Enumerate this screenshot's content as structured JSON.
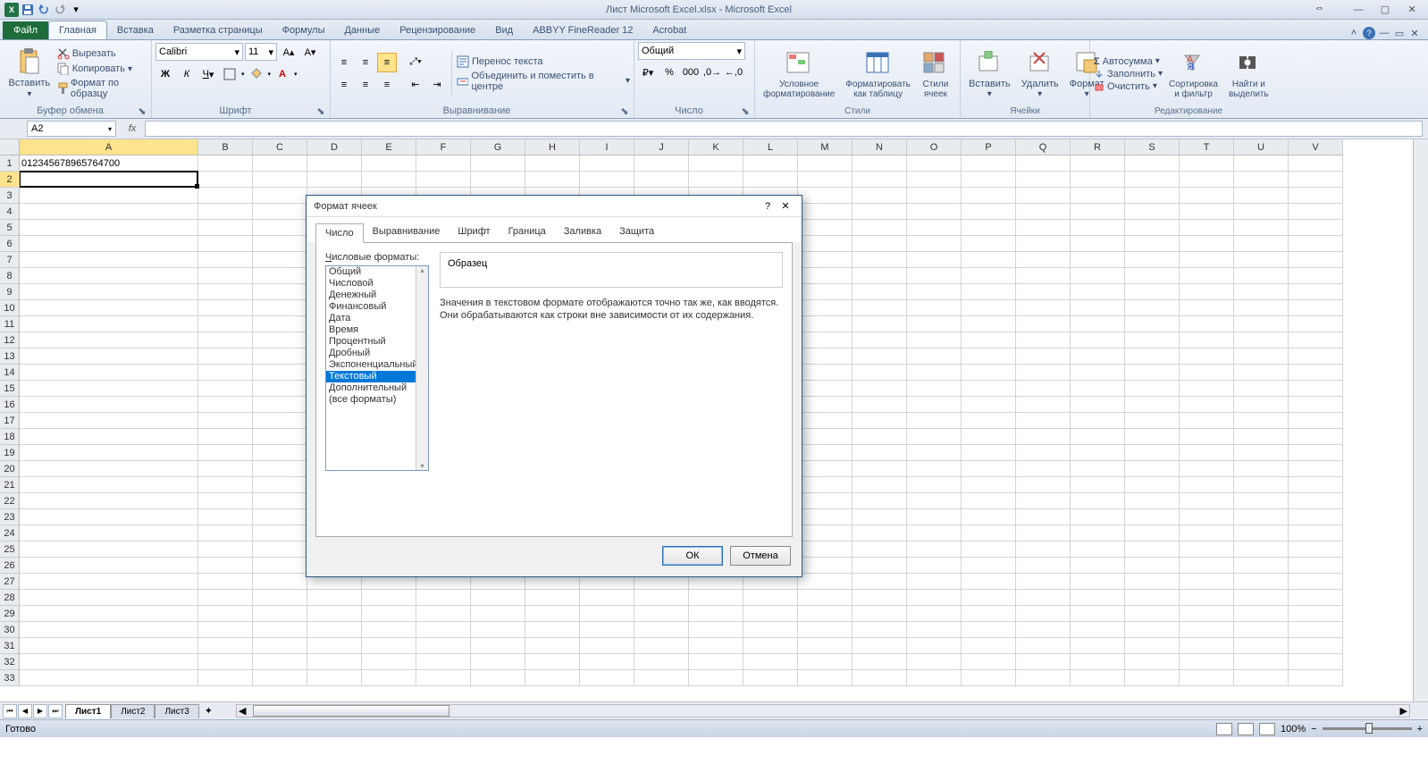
{
  "title": "Лист Microsoft Excel.xlsx - Microsoft Excel",
  "tabs": {
    "file": "Файл",
    "items": [
      "Главная",
      "Вставка",
      "Разметка страницы",
      "Формулы",
      "Данные",
      "Рецензирование",
      "Вид",
      "ABBYY FineReader 12",
      "Acrobat"
    ],
    "active": 0
  },
  "ribbon": {
    "clipboard": {
      "label": "Буфер обмена",
      "paste": "Вставить",
      "cut": "Вырезать",
      "copy": "Копировать",
      "format_painter": "Формат по образцу"
    },
    "font": {
      "label": "Шрифт",
      "name": "Calibri",
      "size": "11"
    },
    "alignment": {
      "label": "Выравнивание",
      "wrap": "Перенос текста",
      "merge": "Объединить и поместить в центре"
    },
    "number": {
      "label": "Число",
      "format": "Общий"
    },
    "styles": {
      "label": "Стили",
      "conditional": "Условное\nформатирование",
      "table": "Форматировать\nкак таблицу",
      "cell": "Стили\nячеек"
    },
    "cells": {
      "label": "Ячейки",
      "insert": "Вставить",
      "delete": "Удалить",
      "format": "Формат"
    },
    "editing": {
      "label": "Редактирование",
      "autosum": "Автосумма",
      "fill": "Заполнить",
      "clear": "Очистить",
      "sort": "Сортировка\nи фильтр",
      "find": "Найти и\nвыделить"
    }
  },
  "namebox": "A2",
  "cells": {
    "A1": "012345678965764700"
  },
  "columns": [
    "A",
    "B",
    "C",
    "D",
    "E",
    "F",
    "G",
    "H",
    "I",
    "J",
    "K",
    "L",
    "M",
    "N",
    "O",
    "P",
    "Q",
    "R",
    "S",
    "T",
    "U",
    "V"
  ],
  "col_widths": {
    "A": 200,
    "default": 61
  },
  "sheets": [
    "Лист1",
    "Лист2",
    "Лист3"
  ],
  "status": {
    "ready": "Готово",
    "zoom": "100%"
  },
  "dialog": {
    "title": "Формат ячеек",
    "tabs": [
      "Число",
      "Выравнивание",
      "Шрифт",
      "Граница",
      "Заливка",
      "Защита"
    ],
    "active_tab": 0,
    "list_label": "Числовые форматы:",
    "sample_label": "Образец",
    "description": "Значения в текстовом формате отображаются точно так же, как вводятся. Они обрабатываются как строки вне зависимости от их содержания.",
    "formats": [
      "Общий",
      "Числовой",
      "Денежный",
      "Финансовый",
      "Дата",
      "Время",
      "Процентный",
      "Дробный",
      "Экспоненциальный",
      "Текстовый",
      "Дополнительный",
      "(все форматы)"
    ],
    "selected_format": 9,
    "ok": "ОК",
    "cancel": "Отмена"
  }
}
